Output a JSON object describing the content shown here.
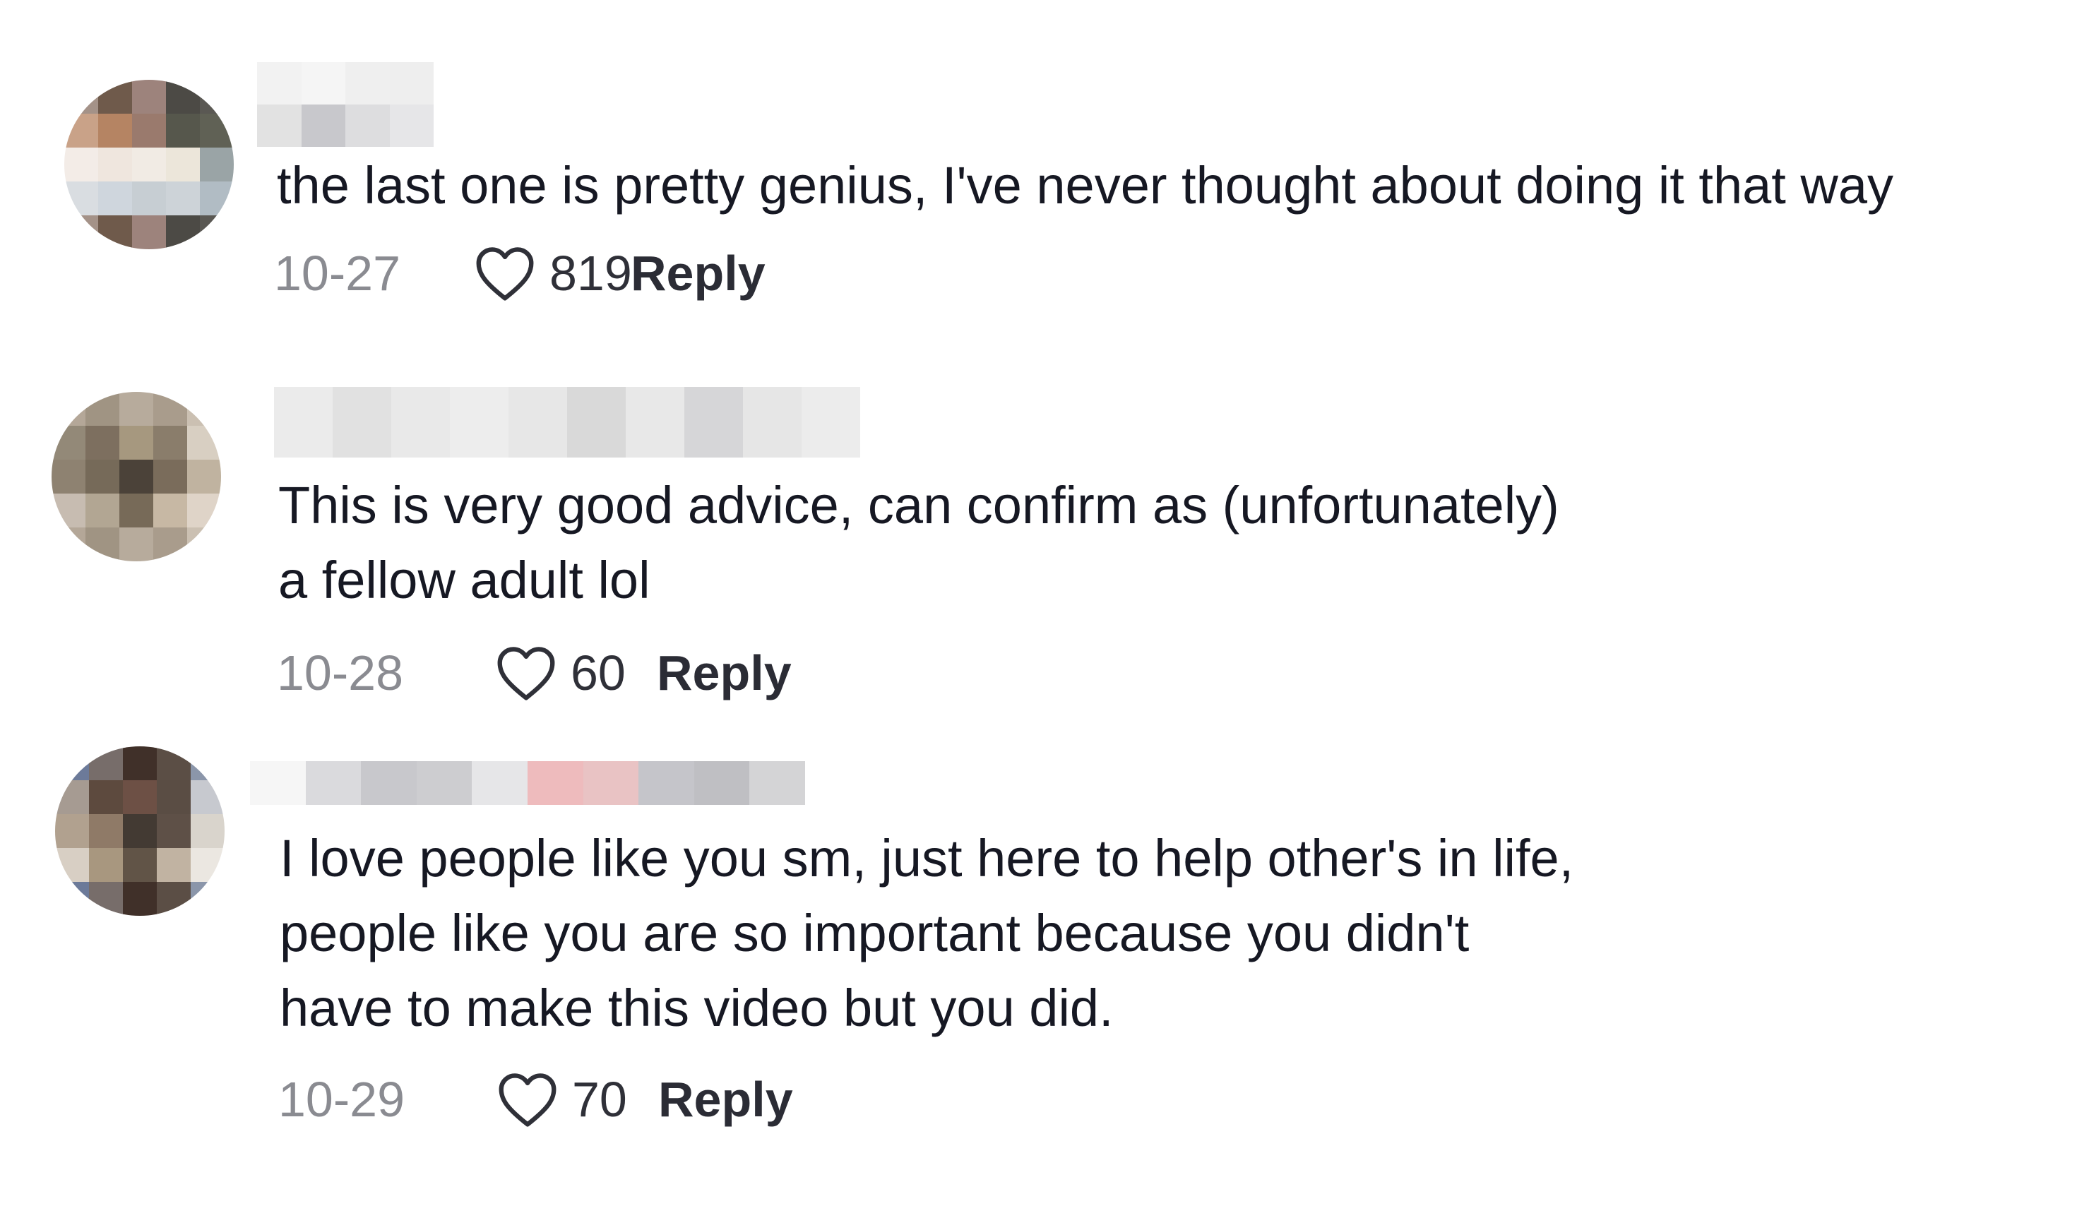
{
  "comments": [
    {
      "text": "the last one is pretty genius, I've never thought about doing it that way",
      "date": "10-27",
      "likes": "819",
      "reply_label": "Reply",
      "avatar_colors": [
        "#a49288",
        "#6f5a4b",
        "#9d837c",
        "#4c4a45",
        "#5a5853",
        "#c9a288",
        "#b58463",
        "#9a7a6d",
        "#56574c",
        "#606155",
        "#f3ece7",
        "#efe6de",
        "#f1ebe4",
        "#ece6da",
        "#9aa4a6",
        "#d9dde1",
        "#cfd6dd",
        "#c7ced3",
        "#cdd3d8",
        "#b1bcc4"
      ]
    },
    {
      "text": "This is very good advice, can confirm as (unfortunately)\na fellow adult lol",
      "date": "10-28",
      "likes": "60",
      "reply_label": "Reply",
      "avatar_colors": [
        "#b4a798",
        "#a09483",
        "#b7ab9c",
        "#a99c8c",
        "#cbc0b2",
        "#938978",
        "#7d6f5f",
        "#a6987f",
        "#8a7d6b",
        "#d8cfc2",
        "#8e8271",
        "#766a59",
        "#4b4239",
        "#7a6c5b",
        "#c0b3a0",
        "#c7bcb1",
        "#b2a693",
        "#776a58",
        "#c7b8a4",
        "#dfd4c8"
      ]
    },
    {
      "text": "I love people like you sm, just here to help other's in life,\npeople like you are so important because you didn't\nhave to make this video but you did.",
      "date": "10-29",
      "likes": "70",
      "reply_label": "Reply",
      "avatar_colors": [
        "#6c7a99",
        "#776d6a",
        "#403029",
        "#5b4e45",
        "#8b96aa",
        "#a69b92",
        "#5d4a3e",
        "#6d5045",
        "#5a4d44",
        "#c7c9cf",
        "#b1a18f",
        "#8f7a67",
        "#433a33",
        "#5e5047",
        "#d9d4cc",
        "#d8cfc4",
        "#a8977f",
        "#615447",
        "#c1b3a2",
        "#ebe7e1"
      ]
    }
  ],
  "colors": {
    "text": "#161823",
    "meta": "#8a8b91",
    "reply": "#2b2c35"
  }
}
